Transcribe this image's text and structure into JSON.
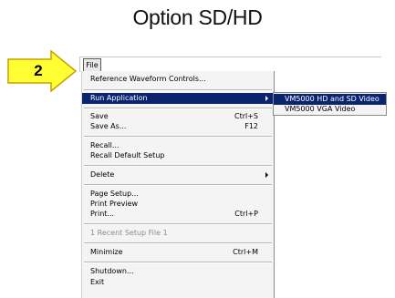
{
  "title": "Option SD/HD",
  "callout": {
    "number": "2"
  },
  "menubar": {
    "file_label": "File"
  },
  "menu": {
    "reference_waveform": {
      "label": "Reference Waveform Controls..."
    },
    "run_application": {
      "label": "Run Application"
    },
    "save": {
      "label": "Save",
      "shortcut": "Ctrl+S"
    },
    "save_as": {
      "label": "Save As...",
      "shortcut": "F12"
    },
    "recall": {
      "label": "Recall..."
    },
    "recall_default": {
      "label": "Recall Default Setup"
    },
    "delete": {
      "label": "Delete"
    },
    "page_setup": {
      "label": "Page Setup..."
    },
    "print_preview": {
      "label": "Print Preview"
    },
    "print": {
      "label": "Print...",
      "shortcut": "Ctrl+P"
    },
    "recent_setup": {
      "label": "1 Recent Setup File 1"
    },
    "minimize": {
      "label": "Minimize",
      "shortcut": "Ctrl+M"
    },
    "shutdown": {
      "label": "Shutdown..."
    },
    "exit": {
      "label": "Exit"
    }
  },
  "submenu": {
    "items": [
      {
        "label": "VM5000 HD and SD Video"
      },
      {
        "label": "VM5000 VGA Video"
      }
    ]
  },
  "colors": {
    "highlight": "#0a2470",
    "callout_fill": "#ffff33",
    "callout_stroke": "#c8a000"
  }
}
